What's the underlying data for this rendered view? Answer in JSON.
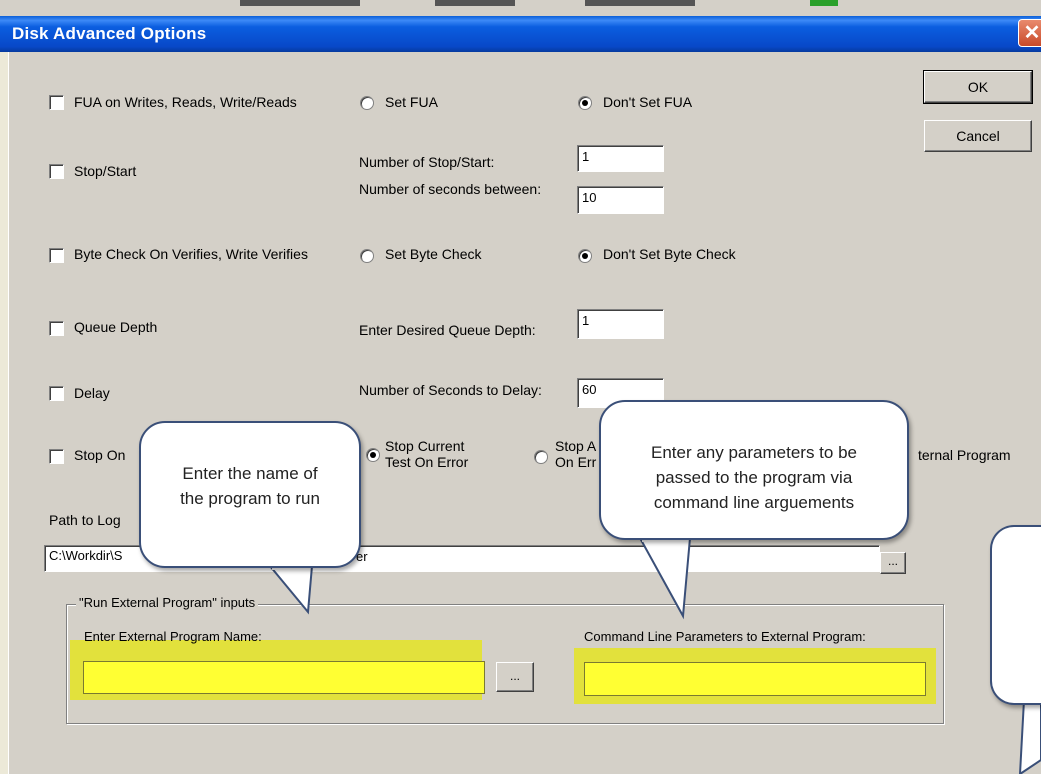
{
  "window": {
    "title": "Disk Advanced Options",
    "close_glyph": "✕"
  },
  "buttons": {
    "ok": "OK",
    "cancel": "Cancel",
    "browse": "..."
  },
  "options": {
    "fua": {
      "label": "FUA on Writes, Reads, Write/Reads",
      "checked": false,
      "radio_set": "Set FUA",
      "radio_dont": "Don't Set FUA"
    },
    "stop_start": {
      "label": "Stop/Start",
      "checked": false,
      "count_label": "Number of Stop/Start:",
      "count_value": "1",
      "seconds_label": "Number of seconds between:",
      "seconds_value": "10"
    },
    "byte_check": {
      "label": "Byte Check On Verifies, Write Verifies",
      "checked": false,
      "radio_set": "Set  Byte Check",
      "radio_dont": "Don't Set Byte Check"
    },
    "queue_depth": {
      "label": "Queue Depth",
      "checked": false,
      "field_label": "Enter Desired Queue Depth:",
      "value": "1"
    },
    "delay": {
      "label": "Delay",
      "checked": false,
      "field_label": "Number of Seconds to Delay:",
      "value": "60"
    },
    "stop_on_error": {
      "label_visible": "Stop On",
      "radio_current_line1": "Stop Current",
      "radio_current_line2": "Test On Error",
      "radio_all_line1": "Stop A",
      "radio_all_line2": "On Err",
      "run_external_fragment": "ternal Program"
    }
  },
  "log_path": {
    "label_visible": "Path to Log",
    "value_start": "C:\\Workdir\\S",
    "value_end": "er"
  },
  "external_group": {
    "title": "\"Run External Program\" inputs",
    "program_label": "Enter External Program Name:",
    "program_value": "",
    "params_label": "Command Line Parameters to External Program:",
    "params_value": ""
  },
  "callouts": {
    "program_name": {
      "line1": "Enter the name of",
      "line2": "the program to run"
    },
    "parameters": {
      "line1": "Enter any parameters to be",
      "line2": "passed to the program via",
      "line3": "command line arguements"
    }
  },
  "colors": {
    "title_bar": "#0b5ee0",
    "highlight": "#ffff33",
    "dialog_bg": "#d4d0c8",
    "callout_border": "#3a4f78"
  }
}
